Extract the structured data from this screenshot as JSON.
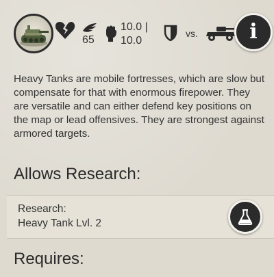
{
  "unit_stats": {
    "speed": "65",
    "attack_line1": "10.0 |",
    "attack_line2": "10.0",
    "vs_label": "vs."
  },
  "icons": {
    "portrait": "heavy-tank-portrait-icon",
    "hit_points": "broken-heart-icon",
    "speed": "wing-icon",
    "attack": "fist-icon",
    "defense": "shield-icon",
    "strong_against": "armored-car-icon",
    "info": "info-icon",
    "research": "flask-icon"
  },
  "description": "Heavy Tanks are mobile fortresses, which are slow but compensate for that with enormous firepower. They are versatile and can either defend key positions on the map or lead offensives. They are strongest against armored targets.",
  "allows_research": {
    "heading": "Allows Research:",
    "item_label": "Research:",
    "item_name": "Heavy Tank Lvl. 2"
  },
  "requires": {
    "heading": "Requires:"
  },
  "colors": {
    "background": "#dedad0",
    "button_dark": "#2b2b2b",
    "text": "#333333"
  }
}
